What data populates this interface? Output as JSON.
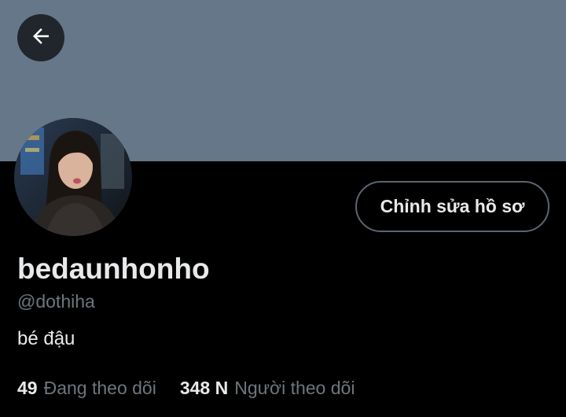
{
  "header": {
    "back_icon": "arrow-left-icon",
    "banner_color": "#66778a"
  },
  "profile": {
    "display_name": "bedaunhonho",
    "handle": "@dothiha",
    "bio": "bé đậu",
    "edit_button_label": "Chỉnh sửa hồ sơ"
  },
  "stats": {
    "following_count": "49",
    "following_label": "Đang theo dõi",
    "followers_count": "348 N",
    "followers_label": "Người theo dõi"
  },
  "colors": {
    "background": "#000000",
    "primary_text": "#e7e9ea",
    "secondary_text": "#6e767d",
    "button_border": "#5c6670"
  }
}
